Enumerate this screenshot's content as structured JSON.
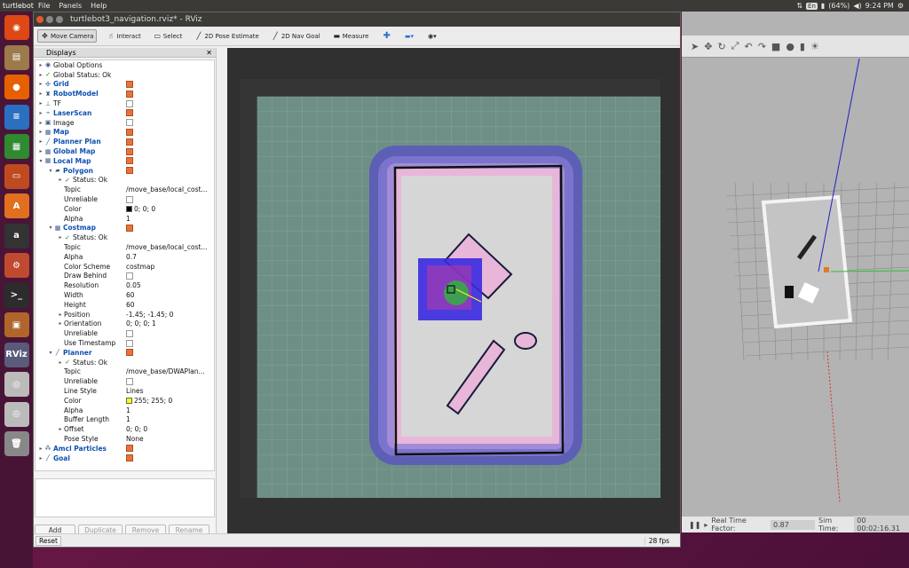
{
  "topbar": {
    "app_name": "turtlebot3",
    "menus": [
      "File",
      "Panels",
      "Help"
    ],
    "lang": "En",
    "battery": "(64%)",
    "time": "9:24 PM"
  },
  "launcher": {
    "icons": [
      {
        "name": "ubuntu-icon",
        "glyph": "◉",
        "color": "#dd4814"
      },
      {
        "name": "files-icon",
        "glyph": "▤",
        "color": "#9c7a4a"
      },
      {
        "name": "firefox-icon",
        "glyph": "●",
        "color": "#e66000"
      },
      {
        "name": "writer-icon",
        "glyph": "≡",
        "color": "#2a6fc0"
      },
      {
        "name": "calc-icon",
        "glyph": "▦",
        "color": "#2f8a30"
      },
      {
        "name": "impress-icon",
        "glyph": "▭",
        "color": "#c04a20"
      },
      {
        "name": "software-icon",
        "glyph": "A",
        "color": "#e07020"
      },
      {
        "name": "amazon-icon",
        "glyph": "a",
        "color": "#333333"
      },
      {
        "name": "settings-icon",
        "glyph": "⚙",
        "color": "#c04a30"
      },
      {
        "name": "terminal-icon",
        "glyph": ">_",
        "color": "#2c2c2c"
      },
      {
        "name": "package-icon",
        "glyph": "▣",
        "color": "#b0662a"
      },
      {
        "name": "rviz-icon",
        "glyph": "RViz",
        "color": "#5a5a7a"
      },
      {
        "name": "dvd-icon",
        "glyph": "◎",
        "color": "#bbbbbb"
      },
      {
        "name": "dvd2-icon",
        "glyph": "◎",
        "color": "#bbbbbb"
      },
      {
        "name": "trash-icon",
        "glyph": "🗑",
        "color": "#888888"
      }
    ]
  },
  "rviz": {
    "title": "turtlebot3_navigation.rviz* - RViz",
    "tools": [
      {
        "label": "Move Camera",
        "icon": "✥",
        "active": true,
        "name": "tool-move-camera"
      },
      {
        "label": "Interact",
        "icon": "☝",
        "active": false,
        "name": "tool-interact"
      },
      {
        "label": "Select",
        "icon": "▭",
        "active": false,
        "name": "tool-select"
      },
      {
        "label": "2D Pose Estimate",
        "icon": "╱",
        "active": false,
        "name": "tool-2d-pose-estimate"
      },
      {
        "label": "2D Nav Goal",
        "icon": "╱",
        "active": false,
        "name": "tool-2d-nav-goal"
      },
      {
        "label": "Measure",
        "icon": "▬",
        "active": false,
        "name": "tool-measure"
      }
    ],
    "displays_title": "Displays",
    "tree": [
      {
        "indent": 0,
        "arrow": "▸",
        "icon": "◉",
        "label": "Global Options",
        "blue": false,
        "check": null,
        "value": ""
      },
      {
        "indent": 0,
        "arrow": "▸",
        "icon": "✓",
        "label": "Global Status: Ok",
        "blue": false,
        "check": null,
        "value": ""
      },
      {
        "indent": 0,
        "arrow": "▸",
        "icon": "✣",
        "label": "Grid",
        "blue": true,
        "check": true,
        "value": ""
      },
      {
        "indent": 0,
        "arrow": "▸",
        "icon": "♜",
        "label": "RobotModel",
        "blue": true,
        "check": true,
        "value": ""
      },
      {
        "indent": 0,
        "arrow": "▸",
        "icon": "⊥",
        "label": "TF",
        "blue": false,
        "check": false,
        "value": ""
      },
      {
        "indent": 0,
        "arrow": "▸",
        "icon": "⌁",
        "label": "LaserScan",
        "blue": true,
        "check": true,
        "value": ""
      },
      {
        "indent": 0,
        "arrow": "▸",
        "icon": "▣",
        "label": "Image",
        "blue": false,
        "check": false,
        "value": ""
      },
      {
        "indent": 0,
        "arrow": "▸",
        "icon": "▦",
        "label": "Map",
        "blue": true,
        "check": true,
        "value": ""
      },
      {
        "indent": 0,
        "arrow": "▸",
        "icon": "╱",
        "label": "Planner Plan",
        "blue": true,
        "check": true,
        "value": ""
      },
      {
        "indent": 0,
        "arrow": "▸",
        "icon": "▦",
        "label": "Global Map",
        "blue": true,
        "check": true,
        "value": ""
      },
      {
        "indent": 0,
        "arrow": "▾",
        "icon": "▦",
        "label": "Local Map",
        "blue": true,
        "check": true,
        "value": ""
      },
      {
        "indent": 1,
        "arrow": "▾",
        "icon": "▰",
        "label": "Polygon",
        "blue": true,
        "check": true,
        "value": ""
      },
      {
        "indent": 2,
        "arrow": "▸",
        "icon": "✓",
        "label": "Status: Ok",
        "blue": false,
        "check": null,
        "value": ""
      },
      {
        "indent": 2,
        "arrow": "",
        "icon": "",
        "label": "Topic",
        "blue": false,
        "check": null,
        "value": "/move_base/local_cost..."
      },
      {
        "indent": 2,
        "arrow": "",
        "icon": "",
        "label": "Unreliable",
        "blue": false,
        "check": false,
        "value": ""
      },
      {
        "indent": 2,
        "arrow": "",
        "icon": "",
        "label": "Color",
        "blue": false,
        "check": null,
        "value": "0; 0; 0",
        "swatch": "#000000"
      },
      {
        "indent": 2,
        "arrow": "",
        "icon": "",
        "label": "Alpha",
        "blue": false,
        "check": null,
        "value": "1"
      },
      {
        "indent": 1,
        "arrow": "▾",
        "icon": "▦",
        "label": "Costmap",
        "blue": true,
        "check": true,
        "value": ""
      },
      {
        "indent": 2,
        "arrow": "▸",
        "icon": "✓",
        "label": "Status: Ok",
        "blue": false,
        "check": null,
        "value": ""
      },
      {
        "indent": 2,
        "arrow": "",
        "icon": "",
        "label": "Topic",
        "blue": false,
        "check": null,
        "value": "/move_base/local_cost..."
      },
      {
        "indent": 2,
        "arrow": "",
        "icon": "",
        "label": "Alpha",
        "blue": false,
        "check": null,
        "value": "0.7"
      },
      {
        "indent": 2,
        "arrow": "",
        "icon": "",
        "label": "Color Scheme",
        "blue": false,
        "check": null,
        "value": "costmap"
      },
      {
        "indent": 2,
        "arrow": "",
        "icon": "",
        "label": "Draw Behind",
        "blue": false,
        "check": false,
        "value": ""
      },
      {
        "indent": 2,
        "arrow": "",
        "icon": "",
        "label": "Resolution",
        "blue": false,
        "check": null,
        "value": "0.05"
      },
      {
        "indent": 2,
        "arrow": "",
        "icon": "",
        "label": "Width",
        "blue": false,
        "check": null,
        "value": "60"
      },
      {
        "indent": 2,
        "arrow": "",
        "icon": "",
        "label": "Height",
        "blue": false,
        "check": null,
        "value": "60"
      },
      {
        "indent": 2,
        "arrow": "▸",
        "icon": "",
        "label": "Position",
        "blue": false,
        "check": null,
        "value": "-1.45; -1.45; 0"
      },
      {
        "indent": 2,
        "arrow": "▸",
        "icon": "",
        "label": "Orientation",
        "blue": false,
        "check": null,
        "value": "0; 0; 0; 1"
      },
      {
        "indent": 2,
        "arrow": "",
        "icon": "",
        "label": "Unreliable",
        "blue": false,
        "check": false,
        "value": ""
      },
      {
        "indent": 2,
        "arrow": "",
        "icon": "",
        "label": "Use Timestamp",
        "blue": false,
        "check": false,
        "value": ""
      },
      {
        "indent": 1,
        "arrow": "▾",
        "icon": "╱",
        "label": "Planner",
        "blue": true,
        "check": true,
        "value": ""
      },
      {
        "indent": 2,
        "arrow": "▸",
        "icon": "✓",
        "label": "Status: Ok",
        "blue": false,
        "check": null,
        "value": ""
      },
      {
        "indent": 2,
        "arrow": "",
        "icon": "",
        "label": "Topic",
        "blue": false,
        "check": null,
        "value": "/move_base/DWAPlan..."
      },
      {
        "indent": 2,
        "arrow": "",
        "icon": "",
        "label": "Unreliable",
        "blue": false,
        "check": false,
        "value": ""
      },
      {
        "indent": 2,
        "arrow": "",
        "icon": "",
        "label": "Line Style",
        "blue": false,
        "check": null,
        "value": "Lines"
      },
      {
        "indent": 2,
        "arrow": "",
        "icon": "",
        "label": "Color",
        "blue": false,
        "check": null,
        "value": "255; 255; 0",
        "swatch": "#ffff00"
      },
      {
        "indent": 2,
        "arrow": "",
        "icon": "",
        "label": "Alpha",
        "blue": false,
        "check": null,
        "value": "1"
      },
      {
        "indent": 2,
        "arrow": "",
        "icon": "",
        "label": "Buffer Length",
        "blue": false,
        "check": null,
        "value": "1"
      },
      {
        "indent": 2,
        "arrow": "▸",
        "icon": "",
        "label": "Offset",
        "blue": false,
        "check": null,
        "value": "0; 0; 0"
      },
      {
        "indent": 2,
        "arrow": "",
        "icon": "",
        "label": "Pose Style",
        "blue": false,
        "check": null,
        "value": "None"
      },
      {
        "indent": 0,
        "arrow": "▸",
        "icon": "⁂",
        "label": "Amcl Particles",
        "blue": true,
        "check": true,
        "value": ""
      },
      {
        "indent": 0,
        "arrow": "▸",
        "icon": "╱",
        "label": "Goal",
        "blue": true,
        "check": true,
        "value": ""
      }
    ],
    "buttons": [
      {
        "label": "Add",
        "enabled": true,
        "name": "add-button"
      },
      {
        "label": "Duplicate",
        "enabled": false,
        "name": "duplicate-button"
      },
      {
        "label": "Remove",
        "enabled": false,
        "name": "remove-button"
      },
      {
        "label": "Rename",
        "enabled": false,
        "name": "rename-button"
      }
    ],
    "reset_label": "Reset",
    "fps": "28 fps"
  },
  "gazebo": {
    "real_time_factor_label": "Real Time Factor:",
    "real_time_factor": "0.87",
    "sim_time_label": "Sim Time:",
    "sim_time": "00 00:02:16.31"
  },
  "colors": {
    "costmap_outer": "#5a5ab8",
    "costmap_mid": "#a28cd8",
    "costmap_inner": "#e8b6d8",
    "free_space": "#c8c8c8",
    "grid_floor": "#6d8f86"
  }
}
